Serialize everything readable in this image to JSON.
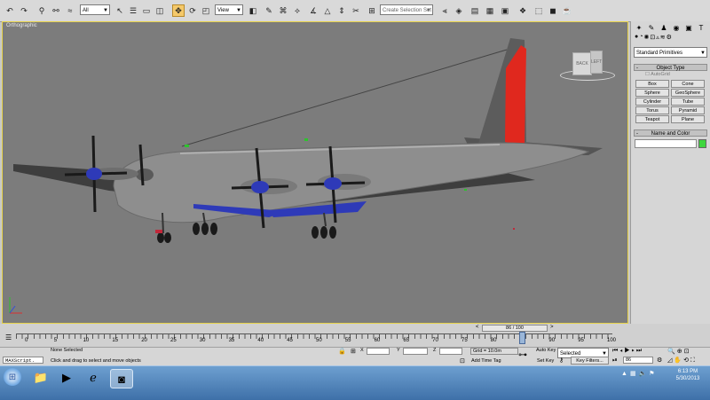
{
  "toolbar": {
    "selection_filter": "All",
    "reference_coord": "View",
    "named_selection_placeholder": "Create Selection Set"
  },
  "viewport": {
    "label": "Orthographic",
    "viewcube_front": "BACK",
    "viewcube_side": "LEFT"
  },
  "command_panel": {
    "category_dropdown": "Standard Primitives",
    "object_type_title": "Object Type",
    "autogrid_label": "AutoGrid",
    "buttons": [
      "Box",
      "Cone",
      "Sphere",
      "GeoSphere",
      "Cylinder",
      "Tube",
      "Torus",
      "Pyramid",
      "Teapot",
      "Plane"
    ],
    "name_color_title": "Name and Color",
    "color_swatch": "#3dd63d"
  },
  "timeline": {
    "slider_label": "86 / 100",
    "ticks": [
      "0",
      "5",
      "10",
      "15",
      "20",
      "25",
      "30",
      "35",
      "40",
      "45",
      "50",
      "55",
      "60",
      "65",
      "70",
      "75",
      "80",
      "85",
      "90",
      "95",
      "100"
    ]
  },
  "status": {
    "script_label": "MAXScript.",
    "selection_status": "None Selected",
    "prompt": "Click and drag to select and move objects",
    "x_label": "X",
    "y_label": "Y",
    "z_label": "Z",
    "grid_label": "Grid = 10.0m",
    "add_time_tag": "Add Time Tag",
    "auto_key": "Auto Key",
    "auto_key_mode": "Selected",
    "set_key": "Set Key",
    "key_filters": "Key Filters...",
    "current_frame": "86"
  },
  "taskbar": {
    "time": "6:13 PM",
    "date": "5/30/2013"
  },
  "colors": {
    "viewport_bg": "#7c7c7c",
    "active_border": "#e6d24a",
    "tail_stripe": "#e0281e",
    "propeller_hub": "#2e3ab8",
    "selection_tool": "#f5c96a"
  }
}
